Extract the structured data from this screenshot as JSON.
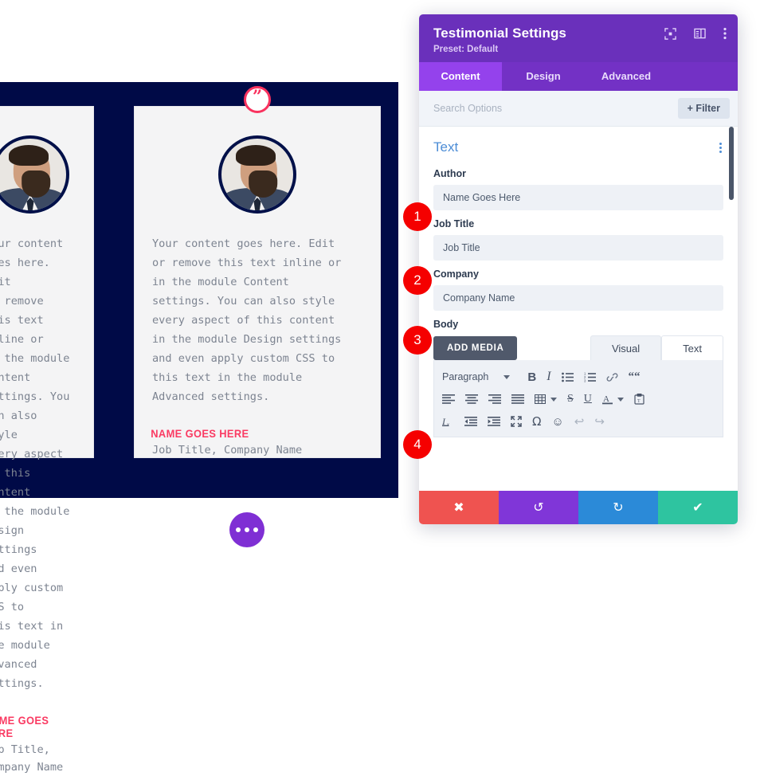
{
  "preview": {
    "quote_badge_glyph": "”",
    "cards": [
      {
        "body": "Your content goes here. Edit\nor remove this text inline or\nin the module Content\nsettings. You can also style\nevery aspect of this content\nin the module Design settings\nand even apply custom CSS to\nthis text in the module\nAdvanced settings.",
        "name": "NAME GOES HERE",
        "meta": "Job Title, Company Name"
      },
      {
        "body": "Your content goes here. Edit\nor remove this text inline or\nin the module Content\nsettings. You can also style\nevery aspect of this content\nin the module Design settings\nand even apply custom CSS to\nthis text in the module\nAdvanced settings.",
        "name": "NAME GOES HERE",
        "meta": "Job Title, Company Name"
      }
    ]
  },
  "panel": {
    "title": "Testimonial Settings",
    "preset": "Preset: Default",
    "header_icons": [
      "focus-icon",
      "layout-panel-icon",
      "more-vertical-icon"
    ],
    "tabs": [
      {
        "label": "Content",
        "active": true
      },
      {
        "label": "Design",
        "active": false
      },
      {
        "label": "Advanced",
        "active": false
      }
    ],
    "search": {
      "placeholder": "Search Options",
      "filter_label": "+ Filter"
    },
    "section": {
      "title": "Text",
      "menu_icon": "more-vertical-icon"
    },
    "fields": [
      {
        "label": "Author",
        "value": "Name Goes Here",
        "step": "1"
      },
      {
        "label": "Job Title",
        "value": "Job Title",
        "step": "2"
      },
      {
        "label": "Company",
        "value": "Company Name",
        "step": "3"
      }
    ],
    "body_field": {
      "label": "Body",
      "add_media_label": "ADD MEDIA",
      "editor_tabs": [
        {
          "label": "Visual",
          "active": true
        },
        {
          "label": "Text",
          "active": false
        }
      ],
      "toolbar": {
        "format_select": "Paragraph",
        "row1": [
          "bold",
          "italic",
          "bulleted-list",
          "numbered-list",
          "link",
          "blockquote"
        ],
        "row2": [
          "align-left",
          "align-center",
          "align-right",
          "align-justify",
          "table",
          "strikethrough",
          "underline",
          "text-color",
          "paste-as-text"
        ],
        "row3": [
          "clear-formatting",
          "outdent",
          "indent",
          "fullscreen",
          "special-character",
          "emoji",
          "undo",
          "redo"
        ]
      },
      "step": "4"
    },
    "actions": [
      {
        "name": "cancel",
        "glyph": "✖",
        "color": "#ef5350"
      },
      {
        "name": "undo",
        "glyph": "↺",
        "color": "#8036d8"
      },
      {
        "name": "redo",
        "glyph": "↻",
        "color": "#2b8ad8"
      },
      {
        "name": "save",
        "glyph": "✔",
        "color": "#2ec4a0"
      }
    ]
  },
  "floating": {
    "dots_button": "page-settings-dots"
  }
}
